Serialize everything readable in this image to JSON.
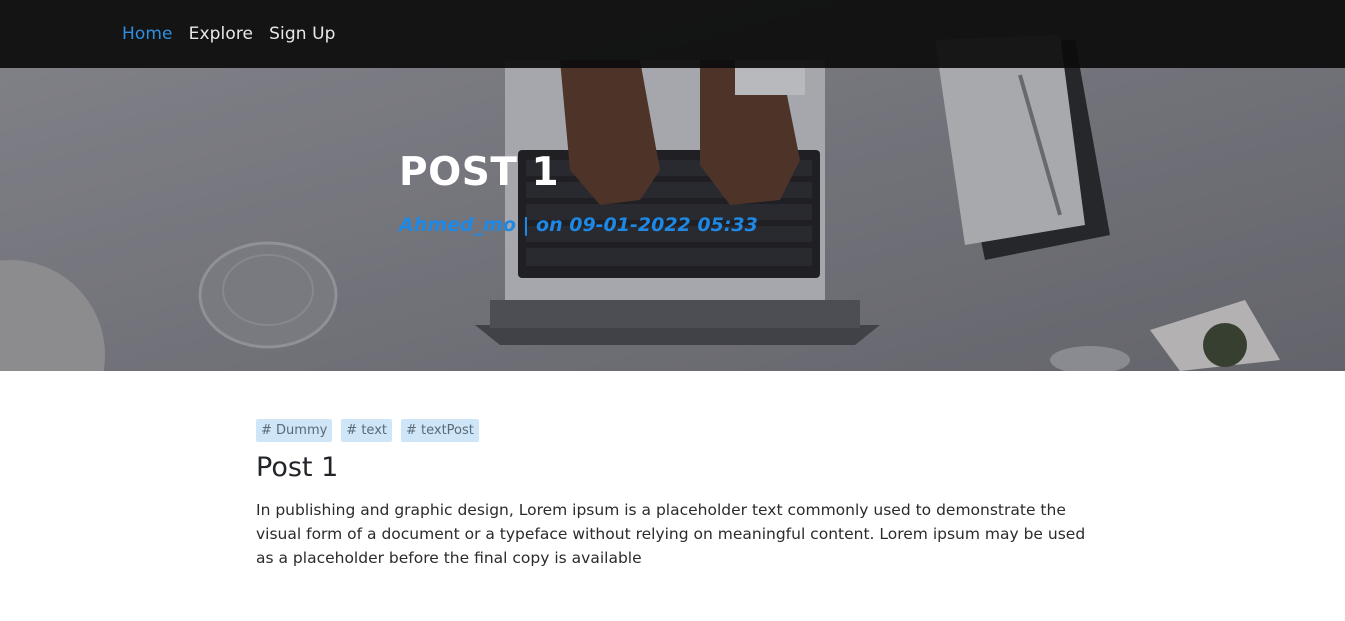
{
  "nav": {
    "items": [
      {
        "label": "Home",
        "active": true
      },
      {
        "label": "Explore",
        "active": false
      },
      {
        "label": "Sign Up",
        "active": false
      }
    ]
  },
  "post": {
    "title": "POST 1",
    "meta": "Ahmed_mo | on 09-01-2022 05:33",
    "tags": [
      "# Dummy",
      "# text",
      "# textPost"
    ],
    "content_title": "Post 1",
    "body": "In publishing and graphic design, Lorem ipsum is a placeholder text commonly used to demonstrate the visual form of a document or a typeface without relying on meaningful content. Lorem ipsum may be used as a placeholder before the final copy is available"
  },
  "colors": {
    "accent": "#1e88e5",
    "nav_active": "#2f8fde",
    "tag_bg": "#cfe6f8",
    "navbar_bg": "#0c0c0c"
  }
}
